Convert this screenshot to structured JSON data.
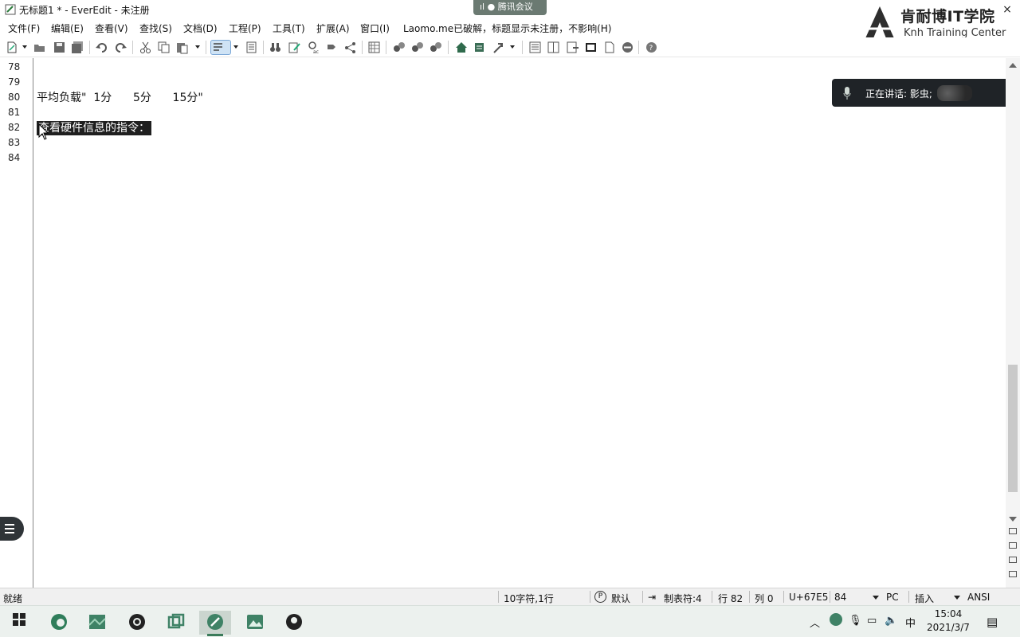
{
  "window": {
    "title": "无标题1 * - EverEdit - 未注册",
    "meeting_label": "腾讯会议",
    "brand_cn": "肯耐博IT学院",
    "brand_en": "Knh  Training Center",
    "close_glyph": "×"
  },
  "menu": {
    "items": [
      "文件(F)",
      "编辑(E)",
      "查看(V)",
      "查找(S)",
      "文档(D)",
      "工程(P)",
      "工具(T)",
      "扩展(A)",
      "窗口(I)",
      "Laomo.me已破解，标题显示未注册，不影响(H)"
    ]
  },
  "editor": {
    "lines": [
      {
        "num": "78",
        "text": ""
      },
      {
        "num": "79",
        "text": ""
      },
      {
        "num": "80",
        "text": "平均负载\"  1分      5分      15分\""
      },
      {
        "num": "81",
        "text": ""
      },
      {
        "num": "82",
        "text": "查看硬件信息的指令："
      },
      {
        "num": "83",
        "text": ""
      },
      {
        "num": "84",
        "text": ""
      }
    ]
  },
  "speaker": {
    "label": "正在讲话: 影虫;"
  },
  "statusbar": {
    "ready": "就绪",
    "selection": "10字符,1行",
    "profile": "默认",
    "tab": "制表符:4",
    "row": "行 82",
    "col": "列 0",
    "unicode": "U+67E5",
    "code": "84",
    "eol": "PC",
    "mode": "插入",
    "encoding": "ANSI"
  },
  "taskbar": {
    "ime": "中",
    "time": "15:04",
    "date": "2021/3/7"
  },
  "colors": {
    "selection_bg": "#1f1f1f",
    "taskbar_bg": "#ecf1ee",
    "speaker_bg": "#1f2327"
  }
}
